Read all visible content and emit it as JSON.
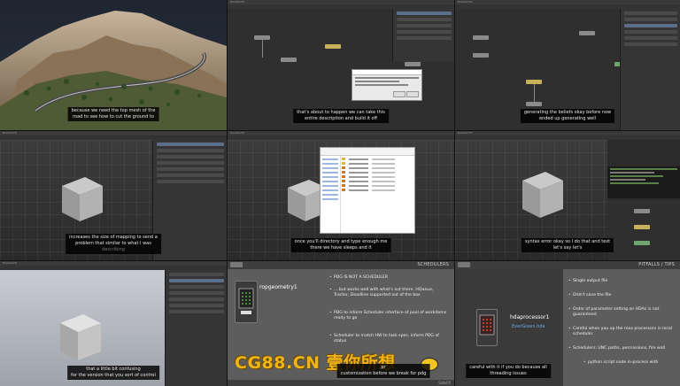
{
  "window_title": "Houdini FX",
  "tiles": [
    {
      "caption_lines": [
        "because we need the top mesh of the",
        "road to see how to cut the ground to"
      ]
    },
    {
      "caption_lines": [
        "that's about to happen we can take this",
        "entire description and build it off"
      ]
    },
    {
      "caption_lines": [
        "generating the beliefs okay before now",
        "ended up generating well"
      ]
    },
    {
      "caption_lines": [
        "increases the size of mapping to send a",
        "problem that similar to what I was"
      ],
      "dim_tail": "describing"
    },
    {
      "caption_lines": [
        "once you'll directory and type enough me",
        "there we have sleeps and it"
      ]
    },
    {
      "caption_lines": [
        "syntax error okay so I do that and text",
        "let's say let's"
      ]
    },
    {
      "caption_lines": [
        "that a little bit confusing",
        "for the version that you sort of control"
      ]
    },
    {
      "caption_lines": [
        "pr",
        "customization before we break for pdg"
      ]
    },
    {
      "caption_lines": [
        "careful with it if you do because all",
        "threading issues"
      ]
    }
  ],
  "slide_scheduler": {
    "title": "SCHEDULERS",
    "bullets": [
      "PDG IS NOT A SCHEDULER",
      "….but works well with what's out there.  HQueue, Tractor, Deadline supported out of the box",
      "PDG to inform Scheduler interface of pool of workitems ready to go",
      "Scheduler to match HW to task spec, inform PDG of status"
    ],
    "node_name": "ropgeometry1"
  },
  "slide_pitfalls": {
    "title": "PITFALLS / TIPS",
    "bullets": [
      "Single output file",
      "Didn't save the file",
      "Order of parameter setting on HDAs is not guaranteed",
      "Careful when you up the max processors in local scheduler",
      "Schedulers: UNC paths, permissions, fire wall",
      "python script node in-process with"
    ],
    "node_name": "hdaprocessor1",
    "node_sub": "EverGreen.hda"
  },
  "watermark": "CG88.CN 壹你所想",
  "brand": "SideFX",
  "colors": {
    "accent": "#f1b418",
    "slide_bg": "#5d5d5d",
    "link": "#6aa9e6"
  }
}
